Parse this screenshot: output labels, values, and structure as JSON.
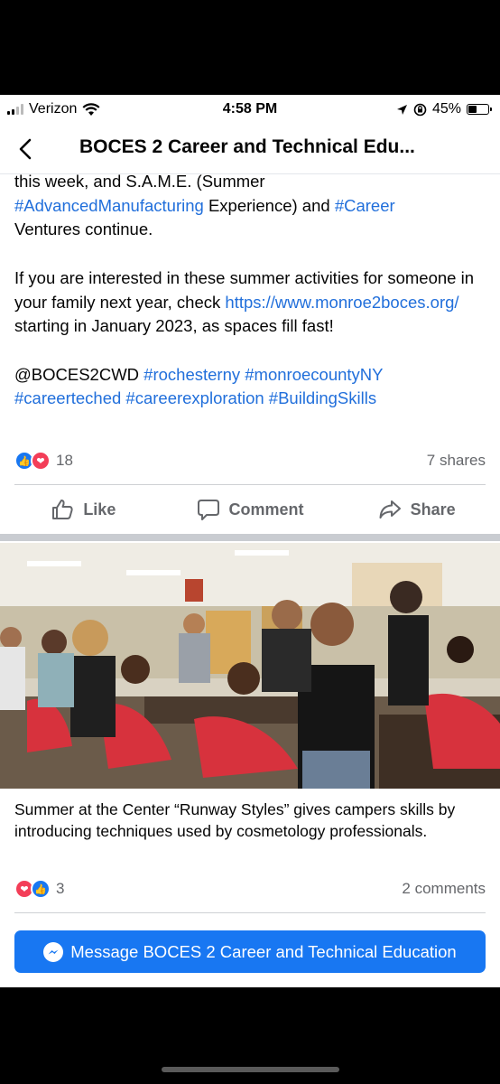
{
  "status_bar": {
    "carrier": "Verizon",
    "time": "4:58 PM",
    "battery": "45%",
    "battery_level": 0.45
  },
  "nav": {
    "title": "BOCES 2 Career and Technical Edu..."
  },
  "post": {
    "line1_a": "this week, and S.A.M.E. (Summer",
    "line2_tag": "#AdvancedManufacturing",
    "line2_b": " Experience) and ",
    "line2_tag2": "#Career",
    "line3": "Ventures continue.",
    "para2_a": "If you are interested in these summer activities for someone in your family next year, check ",
    "para2_link": "https://www.monroe2boces.org/",
    "para2_b": " starting in January 2023, as spaces fill fast!",
    "mention": "@BOCES2CWD",
    "tags": [
      "#rochesterny",
      "#monroecountyNY",
      "#careerteched",
      "#careerexploration",
      "#BuildingSkills"
    ],
    "reaction_count": "18",
    "shares": "7 shares"
  },
  "actions": {
    "like": "Like",
    "comment": "Comment",
    "share": "Share"
  },
  "photo_post": {
    "caption": "Summer at the Center “Runway Styles” gives campers skills by introducing techniques used by cosmetology professionals.",
    "reaction_count": "3",
    "comments": "2 comments"
  },
  "message_button": {
    "label": "Message BOCES 2 Career and Technical Education"
  },
  "colors": {
    "link": "#216fdb",
    "brand_blue": "#1877f2",
    "love_red": "#f33e58"
  },
  "icons": [
    "signal-icon",
    "wifi-icon",
    "location-icon",
    "rotation-lock-icon",
    "battery-icon",
    "back-chevron-icon",
    "like-icon",
    "comment-icon",
    "share-icon",
    "messenger-icon"
  ]
}
